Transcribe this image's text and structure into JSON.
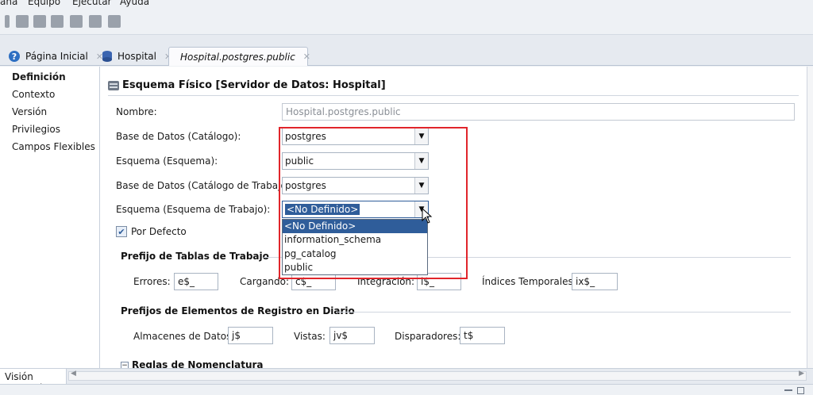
{
  "menubar": {
    "items": [
      "ana",
      "Equipo",
      "Ejecutar",
      "Ayuda"
    ]
  },
  "tabs": [
    {
      "label": "Página Inicial",
      "icon": "help-icon"
    },
    {
      "label": "Hospital",
      "icon": "database-icon"
    },
    {
      "label": "Hospital.postgres.public",
      "icon": "schema-icon"
    }
  ],
  "nav": {
    "items": [
      "Definición",
      "Contexto",
      "Versión",
      "Privilegios",
      "Campos Flexibles"
    ],
    "selected": "Definición"
  },
  "header": {
    "title": "Esquema Físico [Servidor de Datos: Hospital]"
  },
  "form": {
    "name_label": "Nombre:",
    "name_value": "Hospital.postgres.public",
    "catalog_label": "Base de Datos (Catálogo):",
    "catalog_value": "postgres",
    "schema_label": "Esquema (Esquema):",
    "schema_value": "public",
    "work_catalog_label": "Base de Datos (Catálogo de Trabajo):",
    "work_catalog_value": "postgres",
    "work_schema_label": "Esquema (Esquema de Trabajo):",
    "work_schema_value": "<No Definido>",
    "default_label": "Por Defecto",
    "default_checked": true
  },
  "dropdown": {
    "options": [
      "<No Definido>",
      "information_schema",
      "pg_catalog",
      "public"
    ],
    "highlighted": "<No Definido>"
  },
  "prefix_tables": {
    "title": "Prefijo de Tablas de Trabajo",
    "errors_label": "Errores:",
    "errors_value": "e$_",
    "loading_label": "Cargando:",
    "loading_value": "c$_",
    "integration_label": "Integración:",
    "integration_value": "i$_",
    "temp_index_label": "Índices Temporales:",
    "temp_index_value": "ix$_"
  },
  "prefix_journal": {
    "title": "Prefijos de Elementos de Registro en Diario",
    "datastores_label": "Almacenes de Datos:",
    "datastores_value": "j$",
    "views_label": "Vistas:",
    "views_value": "jv$",
    "triggers_label": "Disparadores:",
    "triggers_value": "t$"
  },
  "naming_rules": {
    "title": "Reglas de Nomenclatura"
  },
  "bottom": {
    "tab_label": "Visión General"
  },
  "colors": {
    "accent": "#2f5d9a",
    "highlight_box": "#e1252b"
  }
}
